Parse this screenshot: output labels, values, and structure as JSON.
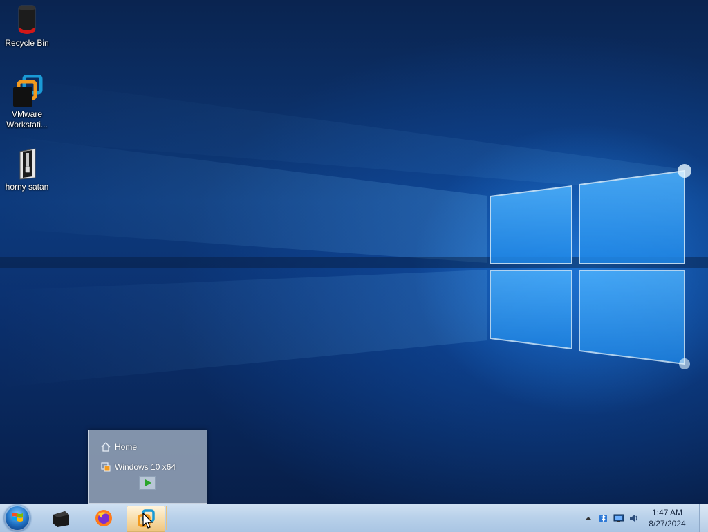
{
  "desktop": {
    "icons": [
      {
        "label": "Recycle Bin"
      },
      {
        "label": "VMware Workstati..."
      },
      {
        "label": "horny satan"
      }
    ]
  },
  "jumplist": {
    "items": [
      {
        "label": "Home",
        "icon": "home-icon"
      },
      {
        "label": "Windows 10 x64",
        "icon": "vm-icon"
      }
    ],
    "play_icon": "play-icon"
  },
  "taskbar": {
    "pinned": [
      {
        "name": "terminal",
        "icon": "black-box-icon"
      },
      {
        "name": "firefox",
        "icon": "firefox-icon"
      },
      {
        "name": "vmware-workstation",
        "icon": "vmware-icon",
        "active": true
      }
    ],
    "tray": {
      "icons": [
        "show-hidden-icons-arrow",
        "bluetooth-icon",
        "network-icon",
        "volume-icon"
      ],
      "time": "1:47 AM",
      "date": "8/27/2024"
    }
  },
  "colors": {
    "accent": "#1f7be0",
    "taskbar": "#b9d1ea",
    "vmware_orange": "#f39a1e",
    "vmware_blue": "#1a9ad6"
  }
}
